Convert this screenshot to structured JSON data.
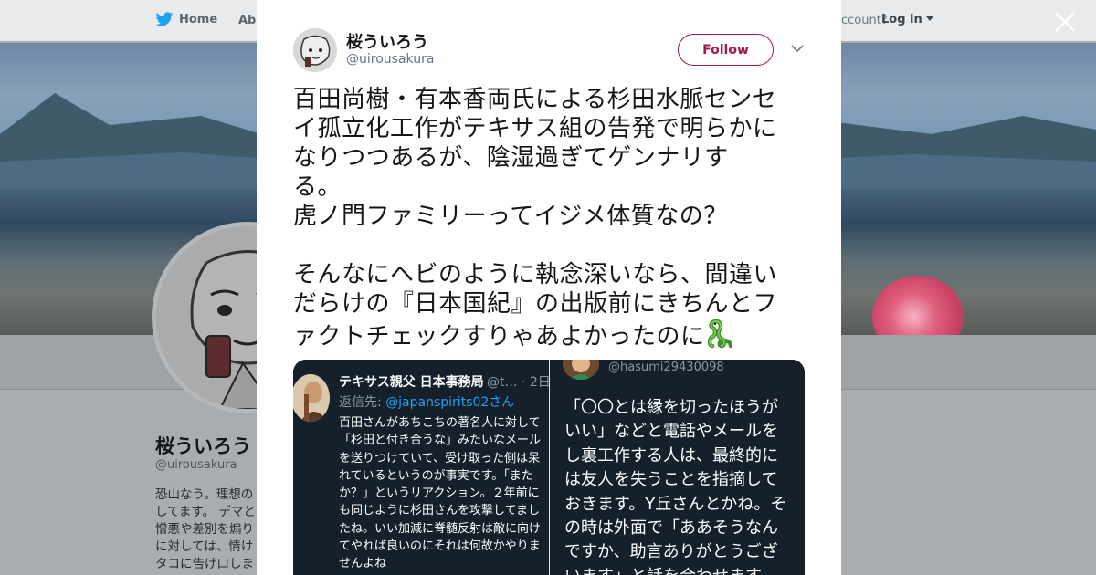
{
  "background": {
    "nav": {
      "home_label": "Home",
      "about_label": "Abo",
      "account_text": "ccount?",
      "login_label": "Log in"
    },
    "profile": {
      "name": "桜ういろう",
      "handle": "@uirousakura",
      "bio_lines": [
        "恐山なう。理想の",
        "してます。 デマと",
        "憎悪や差別を煽り",
        "に対しては、情け",
        "タコに告げ口しま"
      ]
    }
  },
  "modal": {
    "author": {
      "name": "桜ういろう",
      "handle": "@uirousakura"
    },
    "follow_label": "Follow",
    "tweet_lines": [
      "百田尚樹・有本香両氏による杉田水脈センセ",
      "イ孤立化工作がテキサス組の告発で明らかに",
      "なりつつあるが、陰湿過ぎてゲンナリす",
      "る。",
      "虎ノ門ファミリーってイジメ体質なの？",
      "",
      "そんなにヘビのように執念深いなら、間違い",
      "だらけの『日本国紀』の出版前にきちんとフ",
      "ァクトチェックすりゃあよかったのに"
    ],
    "tweet_emoji": "snake-emoji",
    "media": {
      "left": {
        "name": "テキサス親父 日本事務局",
        "meta": "@t… · 2日",
        "reply_prefix": "返信先: ",
        "reply_mention": "@japanspirits02さん",
        "body": "百田さんがあちこちの著名人に対して\n「杉田と付き合うな」みたいなメール\nを送りつけていて、受け取った側は呆\nれているというのが事実です。「また\nか？」というリアクション。２年前に\nも同じように杉田さんを攻撃してまし\nたね。いい加減に脊髄反射は敵に向け\nてやれば良いのにそれは何故かやりま\nせんよね"
      },
      "right": {
        "handle": "@hasumi29430098",
        "body": "「〇〇とは縁を切ったほうが\nいい」などと電話やメールを\nし裏工作する人は、最終的に\nは友人を失うことを指摘して\nおきます。Y丘さんとかね。そ\nの時は外面で「ああそうなん\nですか、助言ありがとうござ\nいます」と話を合わせます"
      }
    }
  },
  "colors": {
    "accent": "#a1174e",
    "overlay": "#a9adb0",
    "media_bg": "#15202b",
    "link": "#1da1f2"
  }
}
